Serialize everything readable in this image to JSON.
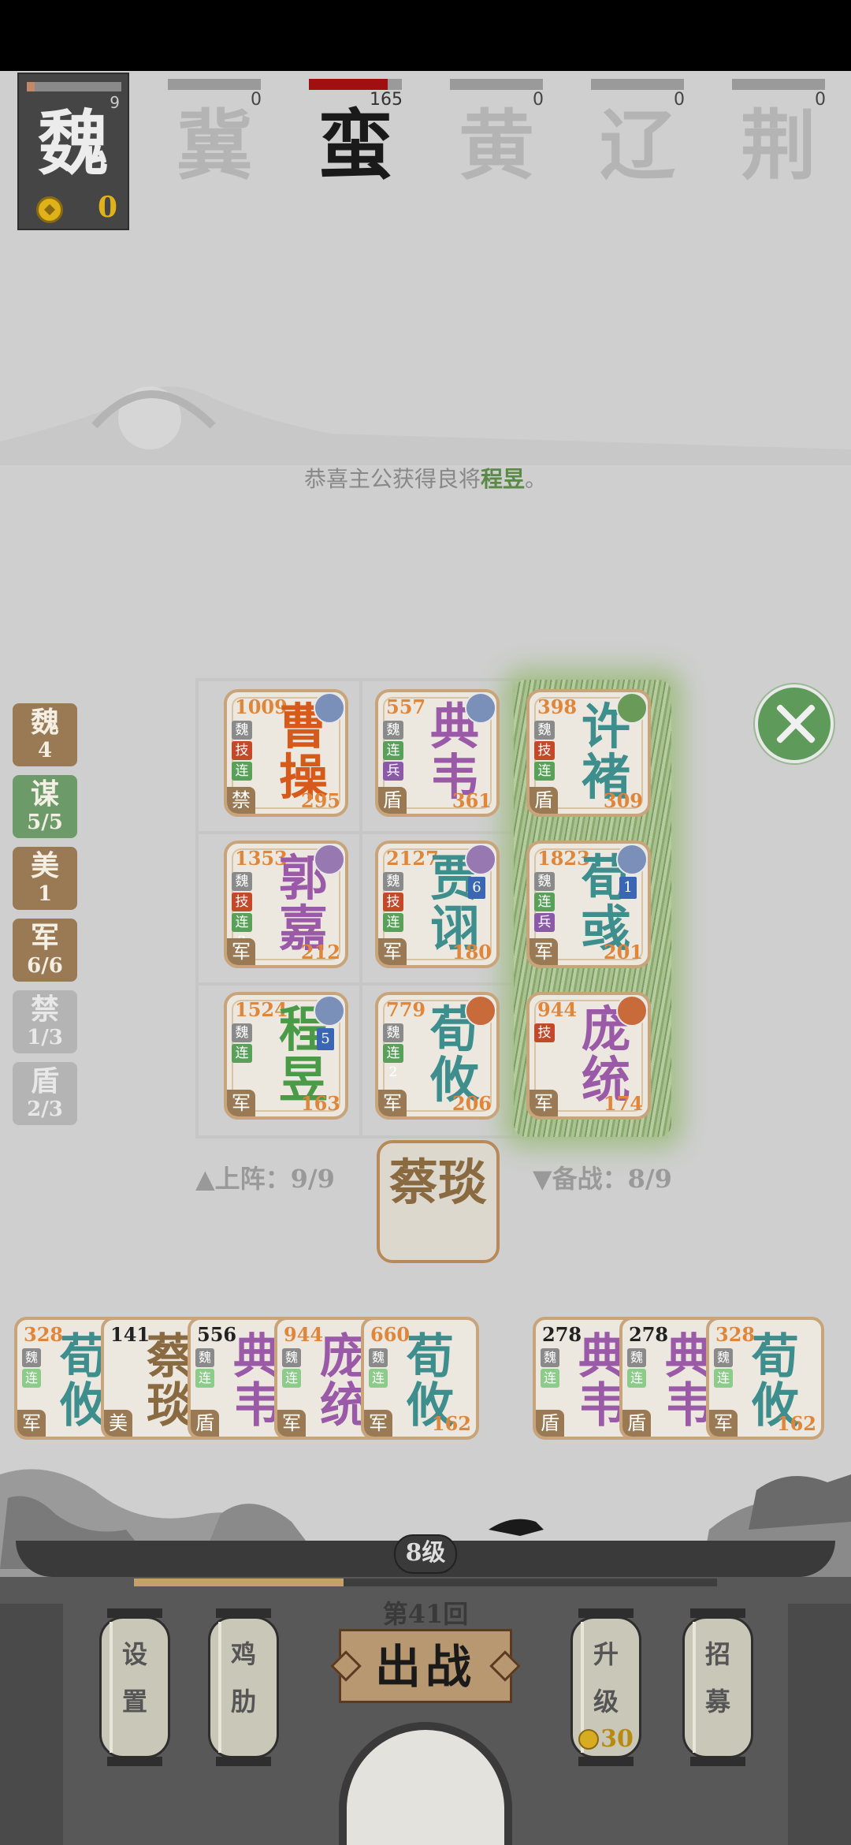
{
  "player": {
    "faction": "魏",
    "count": "9",
    "gold": "0",
    "progress": 0.08
  },
  "enemies": [
    {
      "name": "冀",
      "value": "0",
      "progress": 0,
      "active": false
    },
    {
      "name": "蛮",
      "value": "165",
      "progress": 0.85,
      "active": true
    },
    {
      "name": "黄",
      "value": "0",
      "progress": 0,
      "active": false
    },
    {
      "name": "辽",
      "value": "0",
      "progress": 0,
      "active": false
    },
    {
      "name": "荆",
      "value": "0",
      "progress": 0,
      "active": false
    }
  ],
  "message": {
    "prefix": "恭喜主公获得良将",
    "hero": "程昱",
    "suffix": "。"
  },
  "tags": [
    {
      "label": "魏",
      "count": "4",
      "style": "brown"
    },
    {
      "label": "谋",
      "count": "5/5",
      "style": "green"
    },
    {
      "label": "美",
      "count": "1",
      "style": "brown"
    },
    {
      "label": "军",
      "count": "6/6",
      "style": "brown"
    },
    {
      "label": "禁",
      "count": "1/3",
      "style": "gray"
    },
    {
      "label": "盾",
      "count": "2/3",
      "style": "gray"
    }
  ],
  "formation": [
    {
      "name": "曹操",
      "power": "1009",
      "hp": "295",
      "type": "禁",
      "color": "orange",
      "weapon": "blue",
      "badges": [
        "魏",
        "技",
        "连"
      ]
    },
    {
      "name": "典韦",
      "power": "557",
      "hp": "361",
      "type": "盾",
      "color": "purple",
      "weapon": "blue",
      "badges": [
        "魏",
        "连",
        "兵"
      ]
    },
    {
      "name": "许褚",
      "power": "398",
      "hp": "309",
      "type": "盾",
      "color": "teal",
      "weapon": "green",
      "badges": [
        "魏",
        "技",
        "连"
      ]
    },
    {
      "name": "郭嘉",
      "power": "1353",
      "hp": "212",
      "type": "军",
      "color": "purple",
      "weapon": "purple",
      "badges": [
        "魏",
        "技",
        "连2"
      ]
    },
    {
      "name": "贾诩",
      "power": "2127",
      "hp": "180",
      "type": "军",
      "color": "teal",
      "weapon": "purple",
      "badges": [
        "魏",
        "技",
        "连"
      ],
      "level": "6"
    },
    {
      "name": "荀彧",
      "power": "1823",
      "hp": "201",
      "type": "军",
      "color": "teal",
      "weapon": "blue",
      "badges": [
        "魏",
        "连3",
        "兵"
      ],
      "level": "1"
    },
    {
      "name": "程昱",
      "power": "1524",
      "hp": "163",
      "type": "军",
      "color": "green",
      "weapon": "blue",
      "badges": [
        "魏",
        "连"
      ],
      "level": "5"
    },
    {
      "name": "荀攸",
      "power": "779",
      "hp": "206",
      "type": "军",
      "color": "teal",
      "weapon": "orange",
      "badges": [
        "魏",
        "连2"
      ]
    },
    {
      "name": "庞统",
      "power": "944",
      "hp": "174",
      "type": "军",
      "color": "purple",
      "weapon": "orange",
      "badges": [
        "技"
      ]
    }
  ],
  "deploy": {
    "label": "▲上阵：9/9"
  },
  "reserve": {
    "label": "▼备战：8/9"
  },
  "center_card": {
    "name": "蔡琰"
  },
  "bench": [
    {
      "name": "荀攸",
      "power": "328",
      "type": "军",
      "color": "teal",
      "dark": false,
      "hp": ""
    },
    {
      "name": "蔡琰",
      "power": "141",
      "type": "美",
      "color": "brown",
      "dark": true,
      "hp": ""
    },
    {
      "name": "典韦",
      "power": "556",
      "type": "盾",
      "color": "purple",
      "dark": true,
      "hp": ""
    },
    {
      "name": "庞统",
      "power": "944",
      "type": "军",
      "color": "purple",
      "dark": false,
      "hp": ""
    },
    {
      "name": "荀攸",
      "power": "660",
      "type": "军",
      "color": "teal",
      "dark": false,
      "hp": "162"
    },
    {
      "name": "典韦",
      "power": "278",
      "type": "盾",
      "color": "purple",
      "dark": true,
      "hp": ""
    },
    {
      "name": "典韦",
      "power": "278",
      "type": "盾",
      "color": "purple",
      "dark": true,
      "hp": ""
    },
    {
      "name": "荀攸",
      "power": "328",
      "type": "军",
      "color": "teal",
      "dark": false,
      "hp": "162"
    }
  ],
  "level": {
    "label": "8级",
    "progress": 0.36
  },
  "round": {
    "label": "第41回"
  },
  "buttons": {
    "settings": [
      "设",
      "置"
    ],
    "boost": [
      "鸡",
      "肋"
    ],
    "battle": "出战",
    "upgrade": [
      "升",
      "级"
    ],
    "upgrade_cost": "30",
    "recruit": [
      "招",
      "募"
    ]
  },
  "colors": {
    "orange": "#d85a1a",
    "purple": "#9a5aa8",
    "teal": "#3e8e8e",
    "green": "#4a9a48",
    "brown": "#8a6a40",
    "enemy_bar": "#a01010"
  }
}
